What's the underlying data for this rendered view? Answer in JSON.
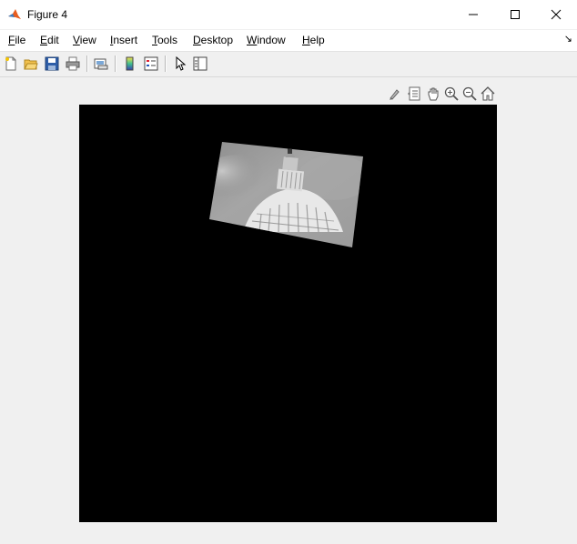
{
  "window": {
    "title": "Figure 4",
    "controls": [
      "minimize",
      "maximize",
      "close"
    ]
  },
  "menubar": {
    "items": [
      "File",
      "Edit",
      "View",
      "Insert",
      "Tools",
      "Desktop",
      "Window",
      "Help"
    ]
  },
  "toolbar": {
    "buttons": [
      "new-figure-icon",
      "open-file-icon",
      "save-icon",
      "print-icon",
      "link-plot-icon",
      "insert-colorbar-icon",
      "insert-legend-icon",
      "edit-plot-icon",
      "open-property-inspector-icon"
    ]
  },
  "axes_toolbar": {
    "buttons": [
      "brush-icon",
      "data-tips-icon",
      "pan-icon",
      "zoom-in-icon",
      "zoom-out-icon",
      "restore-view-icon"
    ]
  },
  "image": {
    "description_colors": {
      "background": "#000000"
    },
    "content": "rotated grayscale photo of capitol dome"
  }
}
